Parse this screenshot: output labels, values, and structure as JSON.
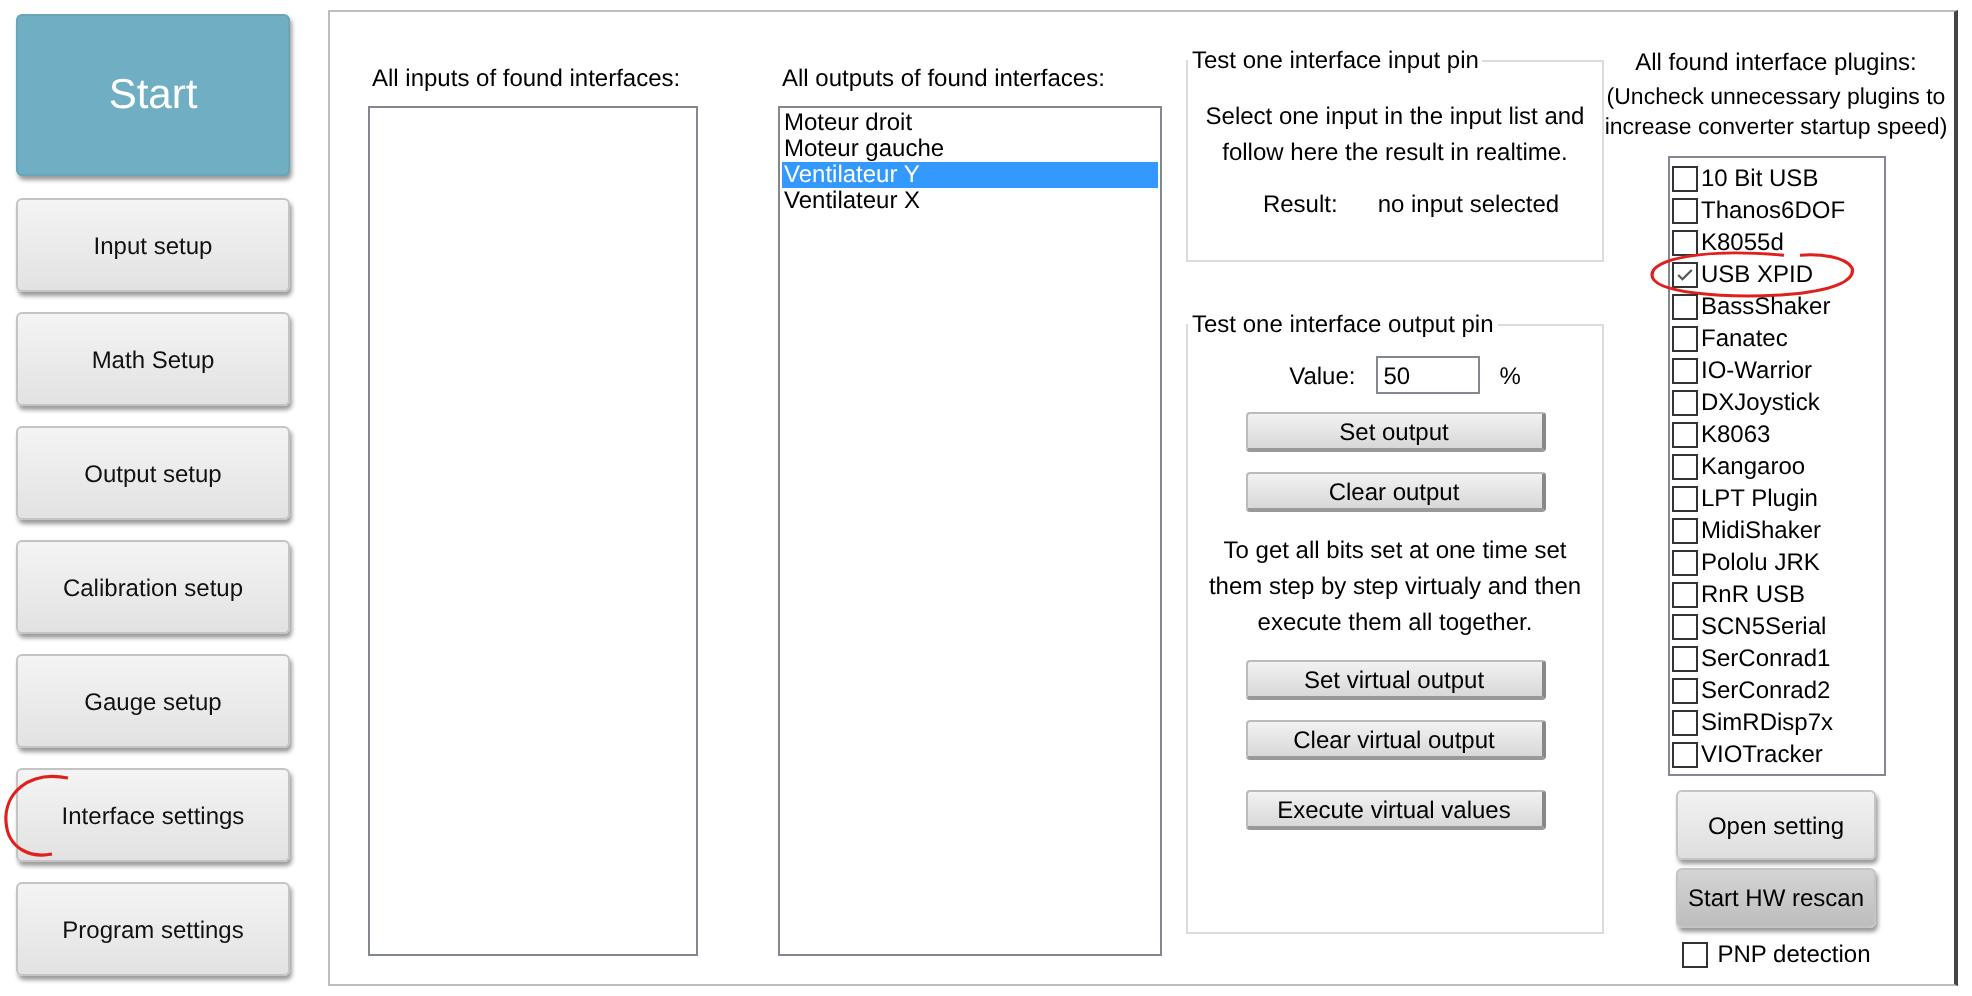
{
  "nav": [
    {
      "label": "Start",
      "kind": "primary"
    },
    {
      "label": "Input setup",
      "kind": "normal"
    },
    {
      "label": "Math Setup",
      "kind": "normal"
    },
    {
      "label": "Output setup",
      "kind": "normal"
    },
    {
      "label": "Calibration setup",
      "kind": "normal"
    },
    {
      "label": "Gauge setup",
      "kind": "normal"
    },
    {
      "label": "Interface settings",
      "kind": "normal",
      "annotated": true
    },
    {
      "label": "Program settings",
      "kind": "normal"
    }
  ],
  "inputs_list": {
    "label": "All inputs of found interfaces:"
  },
  "outputs_list": {
    "label": "All outputs of found interfaces:",
    "items": [
      {
        "label": "Moteur droit",
        "selected": false
      },
      {
        "label": "Moteur gauche",
        "selected": false
      },
      {
        "label": "Ventilateur Y",
        "selected": true
      },
      {
        "label": "Ventilateur X",
        "selected": false
      }
    ]
  },
  "input_test": {
    "title": "Test one interface input pin",
    "instructions": "Select one input in the input list and follow here the result in realtime.",
    "result_label": "Result:",
    "result_value": "no input selected"
  },
  "output_test": {
    "title": "Test one interface output pin",
    "value_label": "Value:",
    "value": "50",
    "unit": "%",
    "buttons": [
      "Set output",
      "Clear output"
    ],
    "note": "To get all bits set at one time set them step by step virtualy and then execute them all together.",
    "virtual_buttons": [
      "Set virtual output",
      "Clear virtual output",
      "Execute virtual values"
    ]
  },
  "plugins": {
    "title": "All found interface plugins:",
    "hint": "(Uncheck unnecessary plugins to increase converter startup speed)",
    "items": [
      {
        "label": "10 Bit USB",
        "checked": false
      },
      {
        "label": "Thanos6DOF",
        "checked": false
      },
      {
        "label": "K8055d",
        "checked": false
      },
      {
        "label": "USB XPID",
        "checked": true,
        "annotated": true
      },
      {
        "label": "BassShaker",
        "checked": false
      },
      {
        "label": "Fanatec",
        "checked": false
      },
      {
        "label": "IO-Warrior",
        "checked": false
      },
      {
        "label": "DXJoystick",
        "checked": false
      },
      {
        "label": "K8063",
        "checked": false
      },
      {
        "label": "Kangaroo",
        "checked": false
      },
      {
        "label": "LPT Plugin",
        "checked": false
      },
      {
        "label": "MidiShaker",
        "checked": false
      },
      {
        "label": "Pololu JRK",
        "checked": false
      },
      {
        "label": "RnR USB",
        "checked": false
      },
      {
        "label": "SCN5Serial",
        "checked": false
      },
      {
        "label": "SerConrad1",
        "checked": false
      },
      {
        "label": "SerConrad2",
        "checked": false
      },
      {
        "label": "SimRDisp7x",
        "checked": false
      },
      {
        "label": "VIOTracker",
        "checked": false
      }
    ],
    "open_button": "Open setting",
    "rescan_button": "Start HW rescan",
    "pnp": {
      "label": "PNP detection",
      "checked": false
    }
  }
}
